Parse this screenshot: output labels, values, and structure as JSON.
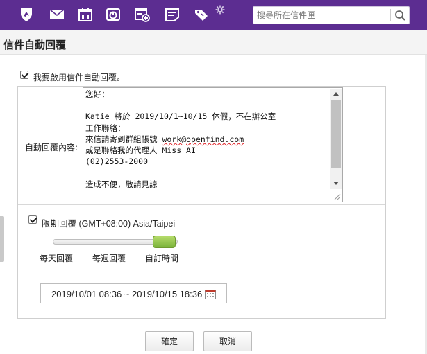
{
  "toolbar": {
    "icons": [
      "home-shield-icon",
      "mail-icon",
      "calendar-icon",
      "disk-icon",
      "compose-calendar-icon",
      "notes-icon",
      "tag-icon",
      "gear-icon"
    ],
    "background": "#5c2d91"
  },
  "search": {
    "placeholder": "搜尋所在信件匣"
  },
  "page": {
    "title": "信件自動回覆"
  },
  "enable": {
    "label": "我要啟用信件自動回覆。",
    "checked": true
  },
  "reply": {
    "label": "自動回覆內容:",
    "lines": [
      "您好：",
      "",
      "Katie 將於 2019/10/1~10/15 休假，不在辦公室",
      "工作聯絡：",
      "來信請寄到群組帳號 work@openfind.com",
      "或是聯絡我的代理人 Miss AI",
      "(02)2553-2000",
      "",
      "造成不便，敬請見諒"
    ]
  },
  "period": {
    "checked": true,
    "label_prefix": "限期回覆",
    "timezone": "(GMT+08:00) Asia/Taipei",
    "options": [
      "每天回覆",
      "每週回覆",
      "自訂時間"
    ],
    "selected_index": 2,
    "range": "2019/10/01 08:36 ~ 2019/10/15 18:36"
  },
  "buttons": {
    "ok": "確定",
    "cancel": "取消"
  },
  "colors": {
    "accent": "#5c2d91",
    "slider_thumb": "#8cc140",
    "spellcheck": "#e0262a"
  }
}
